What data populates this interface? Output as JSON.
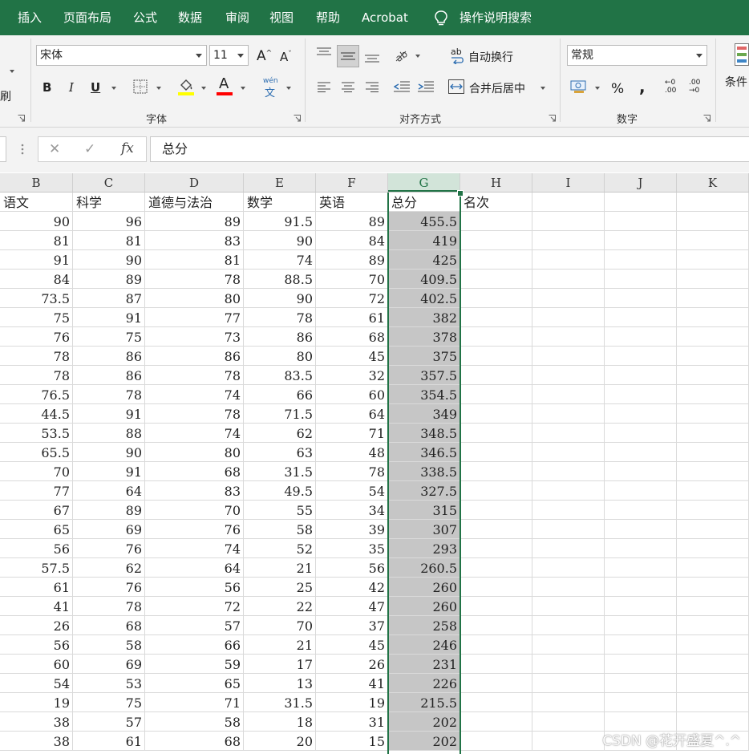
{
  "menu": {
    "tabs": [
      "插入",
      "页面布局",
      "公式",
      "数据",
      "审阅",
      "视图",
      "帮助",
      "Acrobat"
    ],
    "search_label": "操作说明搜索"
  },
  "ribbon": {
    "clipboard_partial": "刷",
    "font": {
      "group_label": "字体",
      "font_name": "宋体",
      "font_size": "11",
      "grow_label": "A",
      "shrink_label": "A",
      "bold": "B",
      "italic": "I",
      "underline": "U",
      "font_color_label": "A",
      "phonetic_top": "wén",
      "phonetic_bottom": "文",
      "fill_color": "#ffff00",
      "font_color": "#ff0000"
    },
    "alignment": {
      "group_label": "对齐方式",
      "wrap_text": "自动换行",
      "merge_center": "合并后居中",
      "wrap_glyph": "ab"
    },
    "number": {
      "group_label": "数字",
      "format": "常规",
      "percent": "%",
      "comma": ",",
      "inc_decimal": "←0 .00",
      "dec_decimal": ".00 →0"
    },
    "styles_partial": "条件"
  },
  "formula_bar": {
    "cancel": "✕",
    "confirm": "✓",
    "fx": "fx",
    "content": "总分"
  },
  "columns": [
    "B",
    "C",
    "D",
    "E",
    "F",
    "G",
    "H",
    "I",
    "J",
    "K"
  ],
  "active_column": "G",
  "headers": [
    "语文",
    "科学",
    "道德与法治",
    "数学",
    "英语",
    "总分",
    "名次"
  ],
  "rows": [
    [
      "90",
      "96",
      "89",
      "91.5",
      "89",
      "455.5"
    ],
    [
      "81",
      "81",
      "83",
      "90",
      "84",
      "419"
    ],
    [
      "91",
      "90",
      "81",
      "74",
      "89",
      "425"
    ],
    [
      "84",
      "89",
      "78",
      "88.5",
      "70",
      "409.5"
    ],
    [
      "73.5",
      "87",
      "80",
      "90",
      "72",
      "402.5"
    ],
    [
      "75",
      "91",
      "77",
      "78",
      "61",
      "382"
    ],
    [
      "76",
      "75",
      "73",
      "86",
      "68",
      "378"
    ],
    [
      "78",
      "86",
      "86",
      "80",
      "45",
      "375"
    ],
    [
      "78",
      "86",
      "78",
      "83.5",
      "32",
      "357.5"
    ],
    [
      "76.5",
      "78",
      "74",
      "66",
      "60",
      "354.5"
    ],
    [
      "44.5",
      "91",
      "78",
      "71.5",
      "64",
      "349"
    ],
    [
      "53.5",
      "88",
      "74",
      "62",
      "71",
      "348.5"
    ],
    [
      "65.5",
      "90",
      "80",
      "63",
      "48",
      "346.5"
    ],
    [
      "70",
      "91",
      "68",
      "31.5",
      "78",
      "338.5"
    ],
    [
      "77",
      "64",
      "83",
      "49.5",
      "54",
      "327.5"
    ],
    [
      "67",
      "89",
      "70",
      "55",
      "34",
      "315"
    ],
    [
      "65",
      "69",
      "76",
      "58",
      "39",
      "307"
    ],
    [
      "56",
      "76",
      "74",
      "52",
      "35",
      "293"
    ],
    [
      "57.5",
      "62",
      "64",
      "21",
      "56",
      "260.5"
    ],
    [
      "61",
      "76",
      "56",
      "25",
      "42",
      "260"
    ],
    [
      "41",
      "78",
      "72",
      "22",
      "47",
      "260"
    ],
    [
      "26",
      "68",
      "57",
      "70",
      "37",
      "258"
    ],
    [
      "56",
      "58",
      "66",
      "21",
      "45",
      "246"
    ],
    [
      "60",
      "69",
      "59",
      "17",
      "26",
      "231"
    ],
    [
      "54",
      "53",
      "65",
      "13",
      "41",
      "226"
    ],
    [
      "19",
      "75",
      "71",
      "31.5",
      "19",
      "215.5"
    ],
    [
      "38",
      "57",
      "58",
      "18",
      "31",
      "202"
    ],
    [
      "38",
      "61",
      "68",
      "20",
      "15",
      "202"
    ]
  ],
  "watermark": "CSDN @花开盛夏^.^",
  "colors": {
    "accent": "#217346",
    "selection_fill": "#c6c6c6"
  }
}
